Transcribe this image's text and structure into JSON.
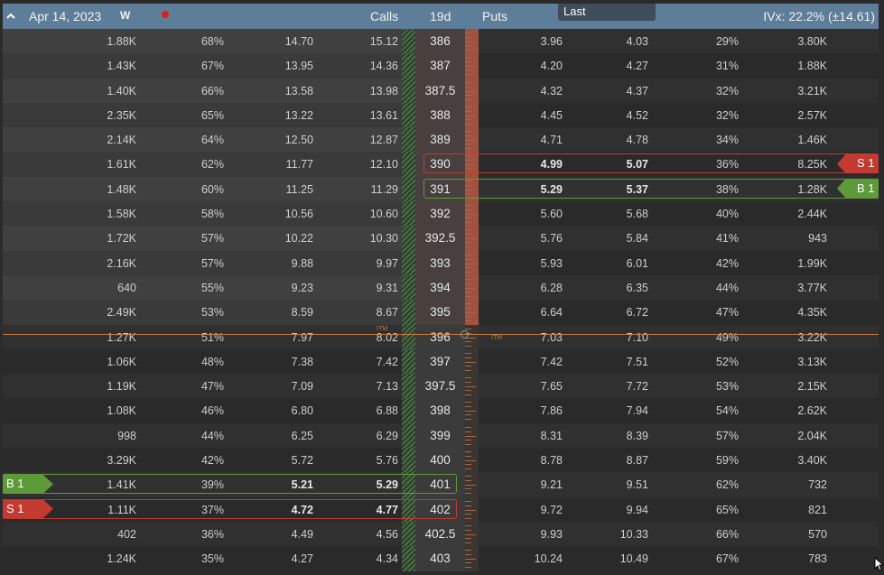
{
  "header": {
    "expiration": "Apr 14, 2023",
    "weekly_badge": "W",
    "calls_label": "Calls",
    "dte_label": "19d",
    "puts_label": "Puts",
    "ivx": "IVx: 22.2% (±14.61)",
    "tooltip": "Last",
    "colors": {
      "header_bg": "#5e7d99",
      "dot": "#e0201a"
    }
  },
  "itm_label": "ITM",
  "rows": [
    {
      "call_vol": "1.88K",
      "call_delta": "68%",
      "call_bid": "14.70",
      "call_ask": "15.12",
      "strike": "386",
      "put_bid": "3.96",
      "put_ask": "4.03",
      "put_delta": "29%",
      "put_vol": "3.80K"
    },
    {
      "call_vol": "1.43K",
      "call_delta": "67%",
      "call_bid": "13.95",
      "call_ask": "14.36",
      "strike": "387",
      "put_bid": "4.20",
      "put_ask": "4.27",
      "put_delta": "31%",
      "put_vol": "1.88K"
    },
    {
      "call_vol": "1.40K",
      "call_delta": "66%",
      "call_bid": "13.58",
      "call_ask": "13.98",
      "strike": "387.5",
      "put_bid": "4.32",
      "put_ask": "4.37",
      "put_delta": "32%",
      "put_vol": "3.21K"
    },
    {
      "call_vol": "2.35K",
      "call_delta": "65%",
      "call_bid": "13.22",
      "call_ask": "13.61",
      "strike": "388",
      "put_bid": "4.45",
      "put_ask": "4.52",
      "put_delta": "32%",
      "put_vol": "2.57K"
    },
    {
      "call_vol": "2.14K",
      "call_delta": "64%",
      "call_bid": "12.50",
      "call_ask": "12.87",
      "strike": "389",
      "put_bid": "4.71",
      "put_ask": "4.78",
      "put_delta": "34%",
      "put_vol": "1.46K"
    },
    {
      "call_vol": "1.61K",
      "call_delta": "62%",
      "call_bid": "11.77",
      "call_ask": "12.10",
      "strike": "390",
      "put_bid": "4.99",
      "put_ask": "5.07",
      "put_delta": "36%",
      "put_vol": "8.25K",
      "put_position": "S 1"
    },
    {
      "call_vol": "1.48K",
      "call_delta": "60%",
      "call_bid": "11.25",
      "call_ask": "11.29",
      "strike": "391",
      "put_bid": "5.29",
      "put_ask": "5.37",
      "put_delta": "38%",
      "put_vol": "1.28K",
      "put_position": "B 1"
    },
    {
      "call_vol": "1.58K",
      "call_delta": "58%",
      "call_bid": "10.56",
      "call_ask": "10.60",
      "strike": "392",
      "put_bid": "5.60",
      "put_ask": "5.68",
      "put_delta": "40%",
      "put_vol": "2.44K"
    },
    {
      "call_vol": "1.72K",
      "call_delta": "57%",
      "call_bid": "10.22",
      "call_ask": "10.30",
      "strike": "392.5",
      "put_bid": "5.76",
      "put_ask": "5.84",
      "put_delta": "41%",
      "put_vol": "943"
    },
    {
      "call_vol": "2.16K",
      "call_delta": "57%",
      "call_bid": "9.88",
      "call_ask": "9.97",
      "strike": "393",
      "put_bid": "5.93",
      "put_ask": "6.01",
      "put_delta": "42%",
      "put_vol": "1.99K"
    },
    {
      "call_vol": "640",
      "call_delta": "55%",
      "call_bid": "9.23",
      "call_ask": "9.31",
      "strike": "394",
      "put_bid": "6.28",
      "put_ask": "6.35",
      "put_delta": "44%",
      "put_vol": "3.77K"
    },
    {
      "call_vol": "2.49K",
      "call_delta": "53%",
      "call_bid": "8.59",
      "call_ask": "8.67",
      "strike": "395",
      "put_bid": "6.64",
      "put_ask": "6.72",
      "put_delta": "47%",
      "put_vol": "4.35K"
    },
    {
      "call_vol": "1.27K",
      "call_delta": "51%",
      "call_bid": "7.97",
      "call_ask": "8.02",
      "strike": "396",
      "put_bid": "7.03",
      "put_ask": "7.10",
      "put_delta": "49%",
      "put_vol": "3.22K"
    },
    {
      "call_vol": "1.06K",
      "call_delta": "48%",
      "call_bid": "7.38",
      "call_ask": "7.42",
      "strike": "397",
      "put_bid": "7.42",
      "put_ask": "7.51",
      "put_delta": "52%",
      "put_vol": "3.13K"
    },
    {
      "call_vol": "1.19K",
      "call_delta": "47%",
      "call_bid": "7.09",
      "call_ask": "7.13",
      "strike": "397.5",
      "put_bid": "7.65",
      "put_ask": "7.72",
      "put_delta": "53%",
      "put_vol": "2.15K"
    },
    {
      "call_vol": "1.08K",
      "call_delta": "46%",
      "call_bid": "6.80",
      "call_ask": "6.88",
      "strike": "398",
      "put_bid": "7.86",
      "put_ask": "7.94",
      "put_delta": "54%",
      "put_vol": "2.62K"
    },
    {
      "call_vol": "998",
      "call_delta": "44%",
      "call_bid": "6.25",
      "call_ask": "6.29",
      "strike": "399",
      "put_bid": "8.31",
      "put_ask": "8.39",
      "put_delta": "57%",
      "put_vol": "2.04K"
    },
    {
      "call_vol": "3.29K",
      "call_delta": "42%",
      "call_bid": "5.72",
      "call_ask": "5.76",
      "strike": "400",
      "put_bid": "8.78",
      "put_ask": "8.87",
      "put_delta": "59%",
      "put_vol": "3.40K"
    },
    {
      "call_vol": "1.41K",
      "call_delta": "39%",
      "call_bid": "5.21",
      "call_ask": "5.29",
      "strike": "401",
      "put_bid": "9.21",
      "put_ask": "9.51",
      "put_delta": "62%",
      "put_vol": "732",
      "call_position": "B 1"
    },
    {
      "call_vol": "1.11K",
      "call_delta": "37%",
      "call_bid": "4.72",
      "call_ask": "4.77",
      "strike": "402",
      "put_bid": "9.72",
      "put_ask": "9.94",
      "put_delta": "65%",
      "put_vol": "821",
      "call_position": "S 1"
    },
    {
      "call_vol": "402",
      "call_delta": "36%",
      "call_bid": "4.49",
      "call_ask": "4.56",
      "strike": "402.5",
      "put_bid": "9.93",
      "put_ask": "10.33",
      "put_delta": "66%",
      "put_vol": "570"
    },
    {
      "call_vol": "1.24K",
      "call_delta": "35%",
      "call_bid": "4.27",
      "call_ask": "4.34",
      "strike": "403",
      "put_bid": "10.24",
      "put_ask": "10.49",
      "put_delta": "67%",
      "put_vol": "783"
    }
  ]
}
